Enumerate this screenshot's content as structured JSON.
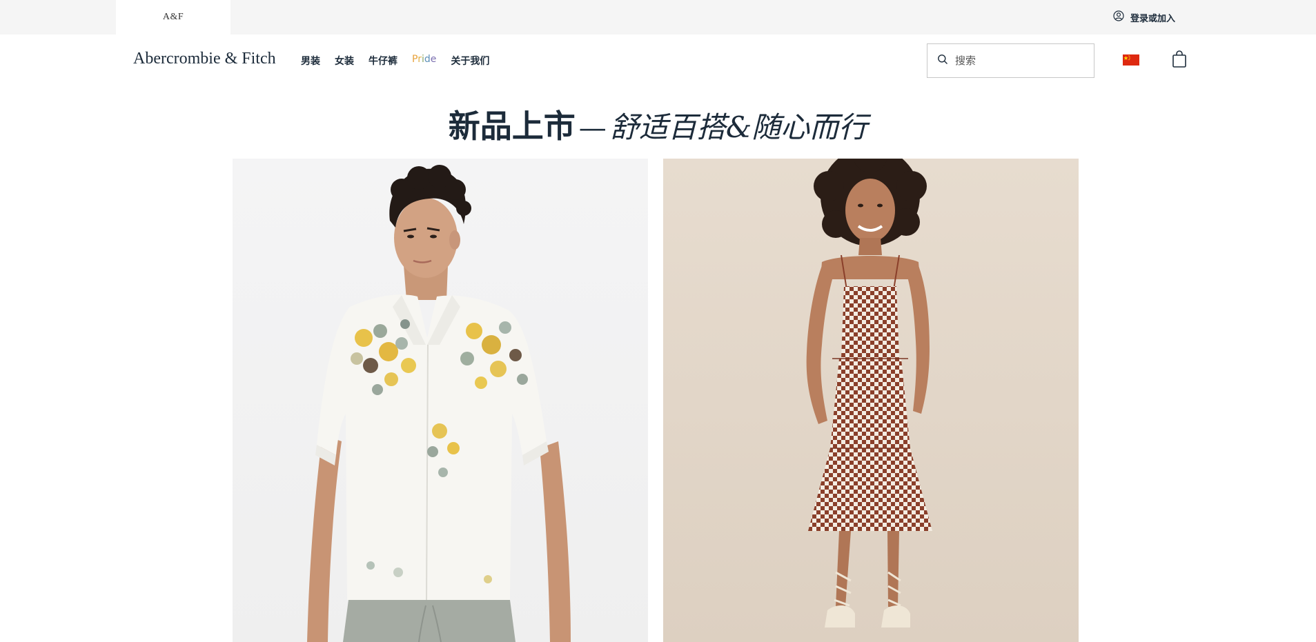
{
  "utility_bar": {
    "brand_tab": "A&F",
    "login_label": "登录或加入"
  },
  "header": {
    "logo": "Abercrombie & Fitch",
    "nav": [
      {
        "label": "男装"
      },
      {
        "label": "女装"
      },
      {
        "label": "牛仔裤"
      },
      {
        "label": "Pride"
      },
      {
        "label": "关于我们"
      }
    ],
    "search_placeholder": "搜索",
    "region_flag": "china-flag-icon",
    "cart_icon": "shopping-bag-icon"
  },
  "hero": {
    "headline_bold": "新品上市",
    "headline_dash": "—",
    "headline_italic": "舒适百搭&随心而行"
  },
  "products": [
    {
      "image": "man-floral-shirt-photo"
    },
    {
      "image": "woman-checkered-dress-photo"
    }
  ],
  "colors": {
    "text": "#1c2b3a",
    "utility_bg": "#f5f5f5",
    "flag_red": "#de2910",
    "flag_yellow": "#ffde00",
    "pride_gradient": [
      "#e8a13a",
      "#e3b04a",
      "#8aa86a",
      "#5b8fb8",
      "#7b6fb0"
    ]
  }
}
